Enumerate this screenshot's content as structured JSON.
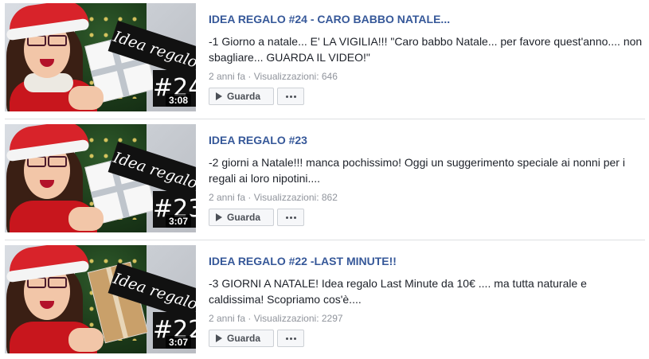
{
  "videos": [
    {
      "title": "IDEA REGALO #24 - CARO BABBO NATALE...",
      "description": "-1 Giorno a natale... E' LA VIGILIA!!! \"Caro babbo Natale... per favore quest'anno.... non sbagliare... GUARDA IL VIDEO!\"",
      "meta": "2 anni fa · Visualizzazioni: 646",
      "duration": "3:08",
      "thumb_sign": "Idea regalo",
      "thumb_number": "#24"
    },
    {
      "title": "IDEA REGALO #23",
      "description": "-2 giorni a Natale!!! manca pochissimo! Oggi un suggerimento speciale ai nonni per i regali ai loro nipotini....",
      "meta": "2 anni fa · Visualizzazioni: 862",
      "duration": "3:07",
      "thumb_sign": "Idea regalo",
      "thumb_number": "#23"
    },
    {
      "title": "IDEA REGALO #22 -LAST MINUTE!!",
      "description": "-3 GIORNI A NATALE! Idea regalo Last Minute da 10€ .... ma tutta naturale e caldissima! Scopriamo cos'è....",
      "meta": "2 anni fa · Visualizzazioni: 2297",
      "duration": "3:07",
      "thumb_sign": "Idea regalo",
      "thumb_number": "#22"
    }
  ],
  "buttons": {
    "watch_label": "Guarda"
  },
  "colors": {
    "link": "#365899",
    "text": "#1d2129",
    "meta": "#90949c",
    "divider": "#dddfe2"
  },
  "icons": {
    "watch": "play-icon",
    "more": "more-dots-icon"
  }
}
